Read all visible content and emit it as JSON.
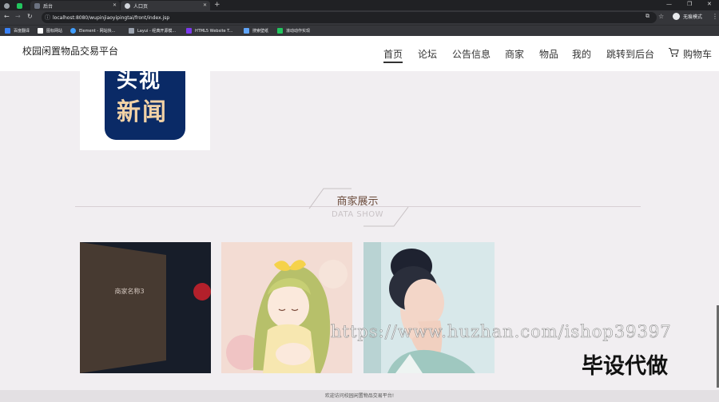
{
  "browser": {
    "tabs": [
      {
        "label": "后台"
      },
      {
        "label": "人口页"
      }
    ],
    "address": "localhost:8080/wupinjiaoyipingtai/front/index.jsp",
    "incognito_label": "无痕模式",
    "bookmarks": [
      {
        "label": "百度翻译",
        "color": "#3b82f6"
      },
      {
        "label": "图标网站",
        "color": "#ffffff"
      },
      {
        "label": "Element - 网站快...",
        "color": "#409eff"
      },
      {
        "label": "Layui - 经典开源模...",
        "color": "#9ca3af"
      },
      {
        "label": "HTML5 Website T...",
        "color": "#7c3aed"
      },
      {
        "label": "搜索壁纸",
        "color": "#60a5fa"
      },
      {
        "label": "滚动动作实现",
        "color": "#22c55e"
      }
    ]
  },
  "site": {
    "brand": "校园闲置物品交易平台",
    "nav": [
      {
        "label": "首页",
        "active": true
      },
      {
        "label": "论坛"
      },
      {
        "label": "公告信息"
      },
      {
        "label": "商家"
      },
      {
        "label": "物品"
      },
      {
        "label": "我的"
      },
      {
        "label": "跳转到后台"
      },
      {
        "label": "购物车"
      }
    ]
  },
  "news_card": {
    "line1": "头视",
    "line2": "新闻"
  },
  "section": {
    "title": "商家展示",
    "subtitle": "DATA SHOW"
  },
  "merchants": [
    {
      "name": "商家名称3"
    },
    {
      "name": ""
    },
    {
      "name": ""
    }
  ],
  "watermark": {
    "url": "https://www.huzhan.com/ishop39397",
    "text": "毕设代做"
  },
  "footer": {
    "text": "欢迎访问校园闲置物品交易平台!"
  },
  "colors": {
    "accent_red": "#b3202b",
    "news_blue": "#0a2a66",
    "title_brown": "#6a4a3a"
  }
}
